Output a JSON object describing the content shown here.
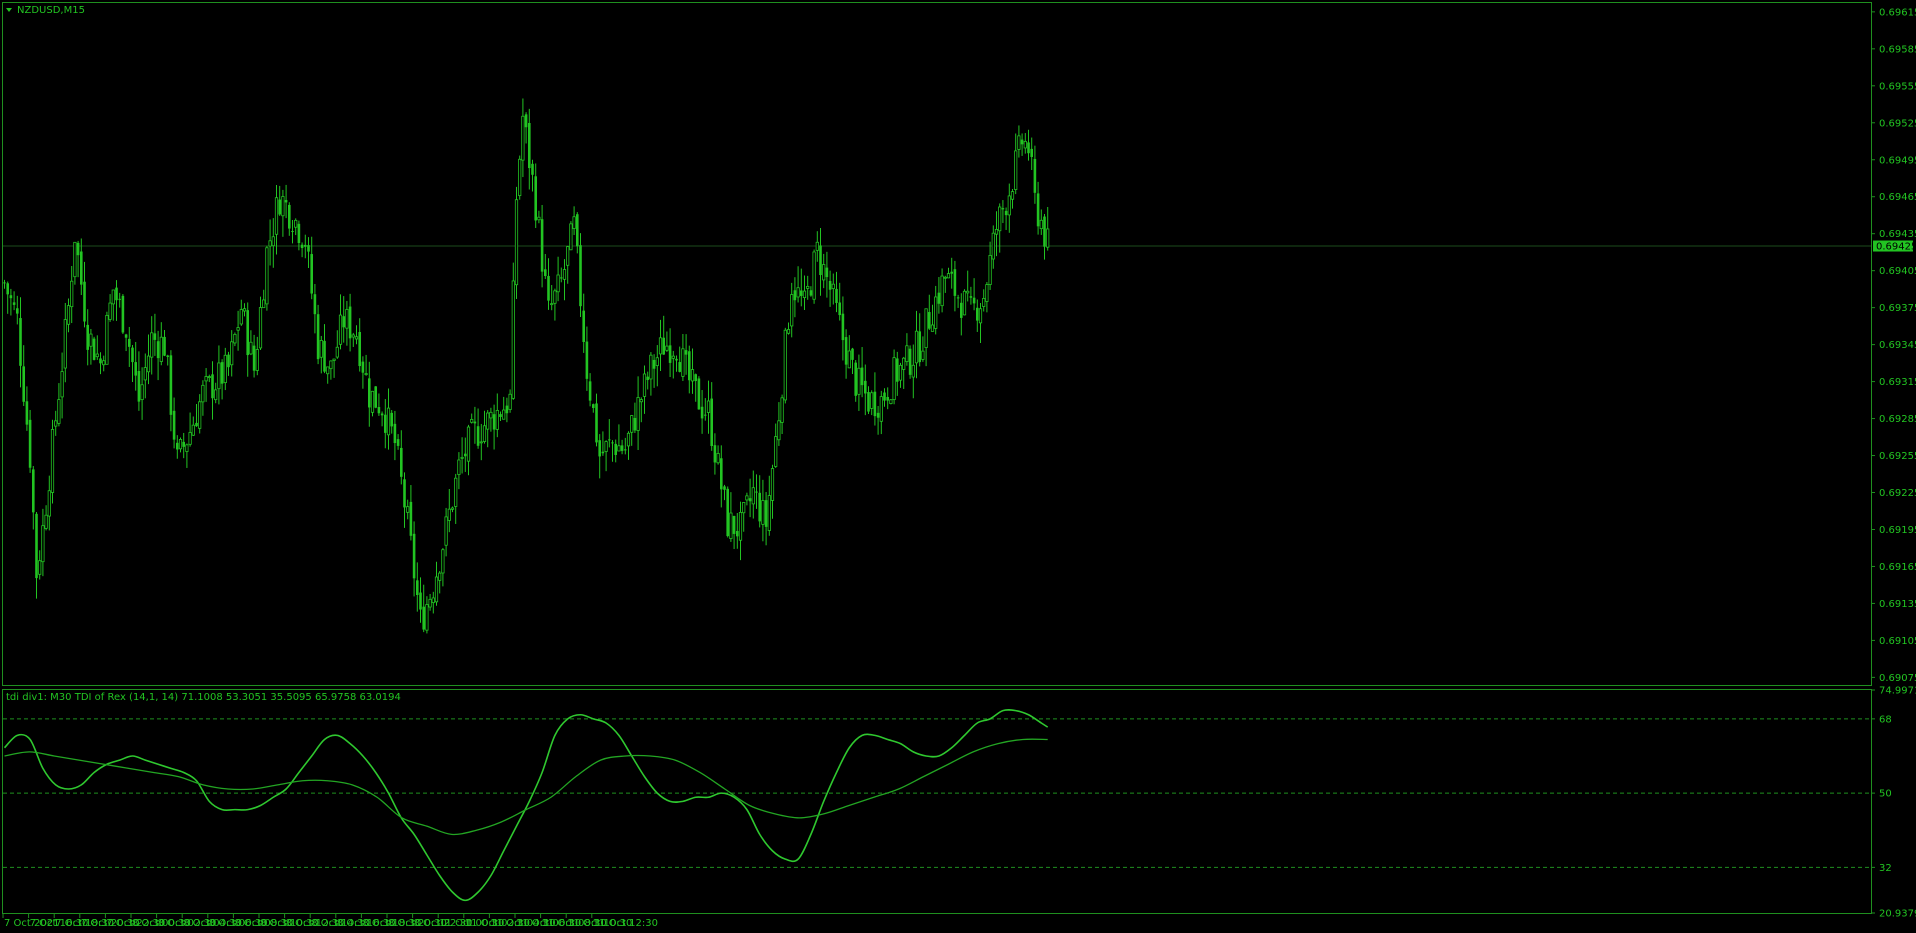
{
  "window": {
    "symbol_title": "NZDUSD,M15",
    "indicator_title": "tdi div1: M30 TDI of Rex  (14,1, 14) 71.1008 53.3051 35.5095 65.9758 63.0194",
    "current_price": "0.69425",
    "colors": {
      "background": "#000000",
      "line": "#1f8f1f",
      "candle": "#22c422",
      "text": "#22c422"
    }
  },
  "chart_data": [
    {
      "type": "candlestick",
      "title": "NZDUSD,M15",
      "price_ticks": [
        "0.69615",
        "0.69585",
        "0.69555",
        "0.69525",
        "0.69495",
        "0.69465",
        "0.69435",
        "0.69405",
        "0.69375",
        "0.69345",
        "0.69315",
        "0.69285",
        "0.69255",
        "0.69225",
        "0.69195",
        "0.69165",
        "0.69135",
        "0.69105",
        "0.69075"
      ],
      "ylim": [
        0.69068,
        0.69623
      ],
      "current_price": 0.69425,
      "time_ticks": [
        "7 Oct 2021",
        "7 Oct 16:30",
        "7 Oct 18:30",
        "7 Oct 20:30",
        "7 Oct 22:30",
        "8 Oct 00:30",
        "8 Oct 02:30",
        "8 Oct 04:30",
        "8 Oct 06:30",
        "8 Oct 08:30",
        "8 Oct 10:30",
        "8 Oct 12:30",
        "8 Oct 14:30",
        "8 Oct 16:30",
        "8 Oct 18:30",
        "8 Oct 20:30",
        "8 Oct 22:30",
        "11 Oct 00:30",
        "11 Oct 02:30",
        "11 Oct 04:30",
        "11 Oct 06:30",
        "11 Oct 08:30",
        "11 Oct 10:30",
        "11 Oct 12:30"
      ],
      "candles_per_tick": 8,
      "key_points": [
        [
          0,
          0.69395
        ],
        [
          4,
          0.69365
        ],
        [
          8,
          0.69255
        ],
        [
          10,
          0.6916
        ],
        [
          12,
          0.69195
        ],
        [
          16,
          0.69285
        ],
        [
          20,
          0.69375
        ],
        [
          22,
          0.69435
        ],
        [
          26,
          0.69355
        ],
        [
          30,
          0.6933
        ],
        [
          34,
          0.6939
        ],
        [
          38,
          0.6936
        ],
        [
          42,
          0.693
        ],
        [
          46,
          0.6935
        ],
        [
          50,
          0.69345
        ],
        [
          54,
          0.6925
        ],
        [
          58,
          0.69275
        ],
        [
          62,
          0.69305
        ],
        [
          66,
          0.69315
        ],
        [
          70,
          0.69325
        ],
        [
          74,
          0.69375
        ],
        [
          78,
          0.69325
        ],
        [
          82,
          0.6942
        ],
        [
          86,
          0.69465
        ],
        [
          90,
          0.6945
        ],
        [
          94,
          0.6943
        ],
        [
          98,
          0.69345
        ],
        [
          102,
          0.69325
        ],
        [
          106,
          0.69365
        ],
        [
          110,
          0.69355
        ],
        [
          114,
          0.69305
        ],
        [
          118,
          0.69295
        ],
        [
          122,
          0.69265
        ],
        [
          126,
          0.692
        ],
        [
          130,
          0.6912
        ],
        [
          134,
          0.6915
        ],
        [
          138,
          0.69195
        ],
        [
          142,
          0.69245
        ],
        [
          146,
          0.6927
        ],
        [
          150,
          0.6928
        ],
        [
          154,
          0.6929
        ],
        [
          158,
          0.693
        ],
        [
          160,
          0.69465
        ],
        [
          162,
          0.6953
        ],
        [
          166,
          0.6946
        ],
        [
          170,
          0.6937
        ],
        [
          174,
          0.69395
        ],
        [
          178,
          0.6944
        ],
        [
          182,
          0.69325
        ],
        [
          186,
          0.69255
        ],
        [
          190,
          0.69265
        ],
        [
          194,
          0.6926
        ],
        [
          198,
          0.69295
        ],
        [
          202,
          0.69325
        ],
        [
          206,
          0.69345
        ],
        [
          210,
          0.69345
        ],
        [
          214,
          0.69315
        ],
        [
          218,
          0.69295
        ],
        [
          220,
          0.6929
        ],
        [
          226,
          0.692
        ],
        [
          230,
          0.69195
        ],
        [
          234,
          0.69225
        ],
        [
          238,
          0.692
        ],
        [
          242,
          0.6929
        ],
        [
          246,
          0.69395
        ],
        [
          250,
          0.69375
        ],
        [
          254,
          0.6942
        ],
        [
          258,
          0.6939
        ],
        [
          262,
          0.6935
        ],
        [
          266,
          0.69315
        ],
        [
          270,
          0.693
        ],
        [
          274,
          0.693
        ],
        [
          278,
          0.6932
        ],
        [
          282,
          0.6933
        ],
        [
          286,
          0.69345
        ],
        [
          290,
          0.69375
        ],
        [
          294,
          0.694
        ],
        [
          298,
          0.69385
        ],
        [
          302,
          0.6937
        ],
        [
          306,
          0.69385
        ],
        [
          310,
          0.6944
        ],
        [
          314,
          0.6947
        ],
        [
          318,
          0.6951
        ],
        [
          320,
          0.69505
        ],
        [
          322,
          0.6946
        ],
        [
          324,
          0.69445
        ],
        [
          326,
          0.69425
        ]
      ]
    },
    {
      "type": "line",
      "title": "tdi div1: M30 TDI of Rex  (14,1, 14) 71.1008 53.3051 35.5095 65.9758 63.0194",
      "y_ticks": [
        "74.9971",
        "68",
        "50",
        "32",
        "20.9379"
      ],
      "ylim": [
        20.9379,
        74.9971
      ],
      "levels": [
        68,
        50,
        32
      ],
      "series": [
        {
          "values": [
            [
              0,
              61
            ],
            [
              4,
              64
            ],
            [
              8,
              63
            ],
            [
              12,
              56
            ],
            [
              16,
              52
            ],
            [
              20,
              51
            ],
            [
              24,
              52
            ],
            [
              28,
              55
            ],
            [
              32,
              57
            ],
            [
              36,
              58
            ],
            [
              40,
              59
            ],
            [
              44,
              58
            ],
            [
              48,
              57
            ],
            [
              52,
              56
            ],
            [
              56,
              55
            ],
            [
              60,
              53
            ],
            [
              64,
              48
            ],
            [
              68,
              46
            ],
            [
              72,
              46
            ],
            [
              76,
              46
            ],
            [
              80,
              47
            ],
            [
              84,
              49
            ],
            [
              88,
              51
            ],
            [
              92,
              55
            ],
            [
              96,
              59
            ],
            [
              100,
              63
            ],
            [
              104,
              64
            ],
            [
              108,
              62
            ],
            [
              112,
              59
            ],
            [
              116,
              55
            ],
            [
              120,
              50
            ],
            [
              124,
              44
            ],
            [
              128,
              40
            ],
            [
              132,
              35
            ],
            [
              136,
              30
            ],
            [
              140,
              26
            ],
            [
              144,
              24
            ],
            [
              148,
              26
            ],
            [
              152,
              30
            ],
            [
              156,
              36
            ],
            [
              160,
              42
            ],
            [
              164,
              48
            ],
            [
              168,
              55
            ],
            [
              172,
              64
            ],
            [
              176,
              68
            ],
            [
              180,
              69
            ],
            [
              184,
              68
            ],
            [
              188,
              67
            ],
            [
              192,
              64
            ],
            [
              196,
              59
            ],
            [
              200,
              54
            ],
            [
              204,
              50
            ],
            [
              208,
              48
            ],
            [
              212,
              48
            ],
            [
              216,
              49
            ],
            [
              220,
              49
            ],
            [
              224,
              50
            ],
            [
              228,
              49
            ],
            [
              232,
              46
            ],
            [
              236,
              40
            ],
            [
              240,
              36
            ],
            [
              244,
              34
            ],
            [
              248,
              34
            ],
            [
              252,
              40
            ],
            [
              256,
              48
            ],
            [
              260,
              55
            ],
            [
              264,
              61
            ],
            [
              268,
              64
            ],
            [
              272,
              64
            ],
            [
              276,
              63
            ],
            [
              280,
              62
            ],
            [
              284,
              60
            ],
            [
              288,
              59
            ],
            [
              292,
              59
            ],
            [
              296,
              61
            ],
            [
              300,
              64
            ],
            [
              304,
              67
            ],
            [
              308,
              68
            ],
            [
              312,
              70
            ],
            [
              316,
              70
            ],
            [
              320,
              69
            ],
            [
              324,
              67
            ],
            [
              326,
              66
            ]
          ]
        },
        {
          "values": [
            [
              0,
              59
            ],
            [
              10,
              60
            ],
            [
              20,
              59
            ],
            [
              30,
              58
            ],
            [
              40,
              57
            ],
            [
              50,
              56
            ],
            [
              60,
              55
            ],
            [
              70,
              54
            ],
            [
              80,
              52
            ],
            [
              90,
              51
            ],
            [
              100,
              51
            ],
            [
              110,
              52
            ],
            [
              120,
              53
            ],
            [
              130,
              53
            ],
            [
              140,
              52
            ],
            [
              150,
              49
            ],
            [
              160,
              44
            ],
            [
              170,
              42
            ],
            [
              180,
              40
            ],
            [
              190,
              41
            ],
            [
              200,
              43
            ],
            [
              210,
              46
            ],
            [
              220,
              49
            ],
            [
              230,
              54
            ],
            [
              240,
              58
            ],
            [
              250,
              59
            ],
            [
              260,
              59
            ],
            [
              270,
              58
            ],
            [
              280,
              55
            ],
            [
              290,
              51
            ],
            [
              300,
              47
            ],
            [
              310,
              45
            ],
            [
              320,
              44
            ],
            [
              330,
              45
            ],
            [
              340,
              47
            ],
            [
              350,
              49
            ],
            [
              360,
              51
            ],
            [
              370,
              54
            ],
            [
              380,
              57
            ],
            [
              390,
              60
            ],
            [
              400,
              62
            ],
            [
              410,
              63
            ],
            [
              420,
              63
            ]
          ]
        }
      ]
    }
  ]
}
